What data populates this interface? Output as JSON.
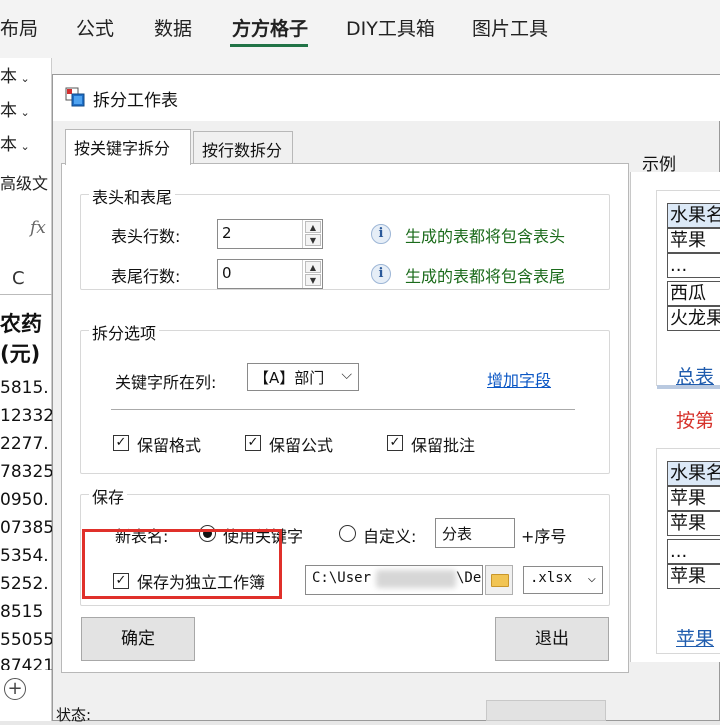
{
  "ribbon": {
    "tabs": [
      "布局",
      "公式",
      "数据",
      "方方格子",
      "DIY工具箱",
      "图片工具"
    ],
    "active_tab": "方方格子",
    "left_items": [
      "本",
      "本",
      "本"
    ],
    "left_more": "高级文"
  },
  "sheet": {
    "fx": "fx",
    "column": "C",
    "header_lines": [
      "农药",
      "(元)"
    ],
    "values": [
      "5815.",
      "12332",
      "2277.",
      "78325",
      "0950.",
      "07385",
      "5354.",
      "5252.",
      "8515",
      "55055",
      "87421"
    ],
    "add_sheet": "+"
  },
  "dialog": {
    "title": "拆分工作表",
    "tabs": [
      "按关键字拆分",
      "按行数拆分"
    ],
    "header_footer": {
      "group_title": "表头和表尾",
      "header_rows_label": "表头行数:",
      "header_rows_value": "2",
      "header_info": "生成的表都将包含表头",
      "footer_rows_label": "表尾行数:",
      "footer_rows_value": "0",
      "footer_info": "生成的表都将包含表尾"
    },
    "split_options": {
      "group_title": "拆分选项",
      "key_col_label": "关键字所在列:",
      "key_col_value": "【A】部门",
      "add_field_link": "增加字段",
      "keep_format": "保留格式",
      "keep_formula": "保留公式",
      "keep_comment": "保留批注"
    },
    "save": {
      "group_title": "保存",
      "new_name_label": "新表名:",
      "use_keyword": "使用关键字",
      "custom": "自定义:",
      "custom_value": "分表",
      "suffix": "+序号",
      "save_as_workbook": "保存为独立工作簿",
      "path_start": "C:\\User",
      "path_end": "\\De",
      "extension": ".xlsx"
    },
    "ok": "确定",
    "exit": "退出",
    "status_label": "状态:"
  },
  "example": {
    "title": "示例",
    "table1": [
      "水果名",
      "苹果",
      "...",
      "西瓜",
      "火龙果"
    ],
    "link1": "总表",
    "caption": "按第",
    "table2": [
      "水果名",
      "苹果",
      "苹果",
      "...",
      "苹果"
    ],
    "link2": "苹果"
  },
  "colors": {
    "accent": "#217346",
    "highlight": "#e0302a",
    "link": "#0b57c5",
    "info": "#1b6b1b"
  }
}
